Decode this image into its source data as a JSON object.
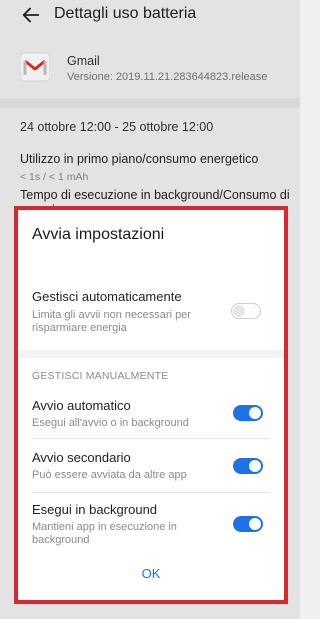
{
  "header": {
    "title": "Dettagli uso batteria",
    "back_icon": "arrow-left-icon"
  },
  "app": {
    "name": "Gmail",
    "version": "Versione: 2019.11.21.283644823.release",
    "icon": "gmail-icon"
  },
  "stats": {
    "date_range": "24 ottobre 12:00 - 25 ottobre 12:00",
    "foreground_title": "Utilizzo in primo piano/consumo energetico",
    "foreground_value": "< 1s / < 1 mAh",
    "background_title": "Tempo di esecuzione in background/Consumo di energia"
  },
  "dialog": {
    "title": "Avvia impostazioni",
    "auto_manage": {
      "title": "Gestisci automaticamente",
      "subtitle": "Limita gli avvii non necessari per risparmiare energia",
      "enabled": false
    },
    "manual_section_label": "GESTISCI MANUALMENTE",
    "auto_launch": {
      "title": "Avvio automatico",
      "subtitle": "Esegui all'avvio o in background",
      "enabled": true
    },
    "secondary_launch": {
      "title": "Avvio secondario",
      "subtitle": "Può essere avviata da altre app",
      "enabled": true
    },
    "run_background": {
      "title": "Esegui in background",
      "subtitle": "Mantieni app in esecuzione in background",
      "enabled": true
    },
    "ok_label": "OK"
  },
  "colors": {
    "accent": "#1d72e6",
    "highlight_frame": "#d7282f",
    "gmail_red": "#d93025"
  }
}
